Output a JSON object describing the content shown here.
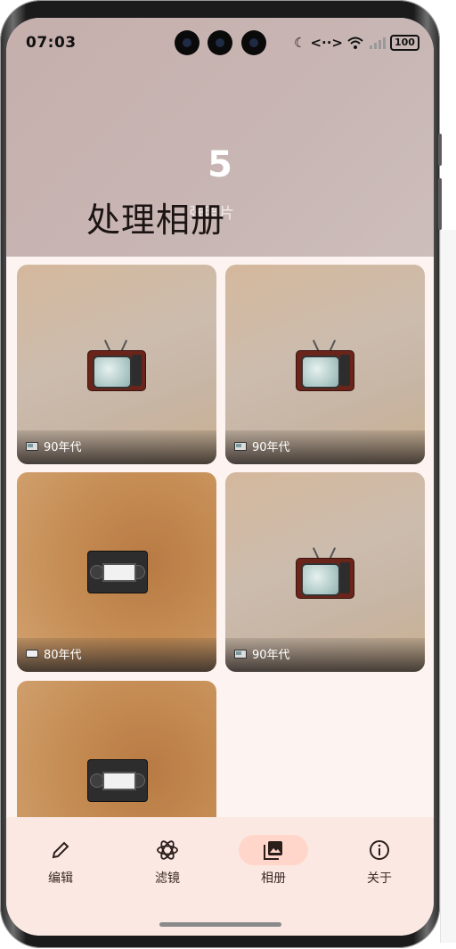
{
  "status_bar": {
    "time": "07:03",
    "network": "<··>",
    "battery": "100"
  },
  "header": {
    "count": "5",
    "subtitle": "张照片",
    "title": "处理相册"
  },
  "photos": [
    {
      "label": "90年代",
      "kind": "tv-icon"
    },
    {
      "label": "90年代",
      "kind": "tv-icon"
    },
    {
      "label": "80年代",
      "kind": "vhs-icon"
    },
    {
      "label": "90年代",
      "kind": "tv-icon"
    },
    {
      "label": "",
      "kind": "vhs-icon"
    }
  ],
  "bottom_nav": {
    "items": [
      {
        "label": "编辑",
        "icon": "pencil-icon"
      },
      {
        "label": "滤镜",
        "icon": "atom-icon"
      },
      {
        "label": "相册",
        "icon": "photo-library-icon",
        "active": true
      },
      {
        "label": "关于",
        "icon": "info-icon"
      }
    ]
  },
  "colors": {
    "accent": "#ffd6c9",
    "nav_bg": "#fbe8e2",
    "header_bg": "#c6afac"
  }
}
